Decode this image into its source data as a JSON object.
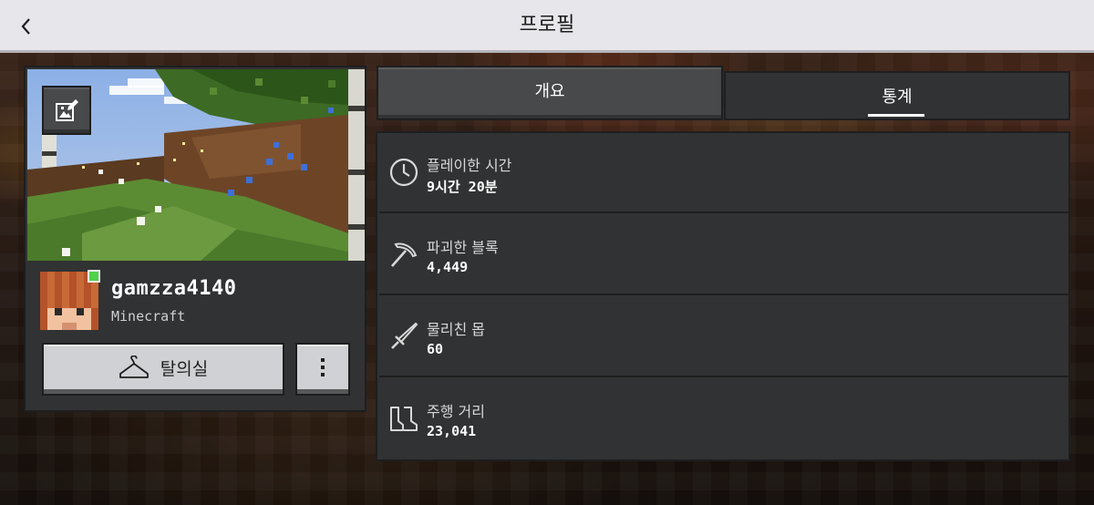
{
  "header": {
    "title": "프로필",
    "back_icon": "chevron-left-icon"
  },
  "profile": {
    "username": "gamzza4140",
    "platform": "Minecraft",
    "online": true,
    "status_color": "#52d24a",
    "edit_icon": "edit-screenshot-icon",
    "dressing_room_label": "탈의실",
    "dressing_room_icon": "hanger-icon",
    "more_icon": "more-vertical-icon"
  },
  "tabs": [
    {
      "label": "개요",
      "selected": false
    },
    {
      "label": "통계",
      "selected": true
    }
  ],
  "stats": [
    {
      "label": "플레이한 시간",
      "value": "9시간 20분",
      "icon": "clock-icon"
    },
    {
      "label": "파괴한 블록",
      "value": "4,449",
      "icon": "pickaxe-icon"
    },
    {
      "label": "물리친 몹",
      "value": "60",
      "icon": "sword-icon"
    },
    {
      "label": "주행 거리",
      "value": "23,041",
      "icon": "boots-icon"
    }
  ]
}
